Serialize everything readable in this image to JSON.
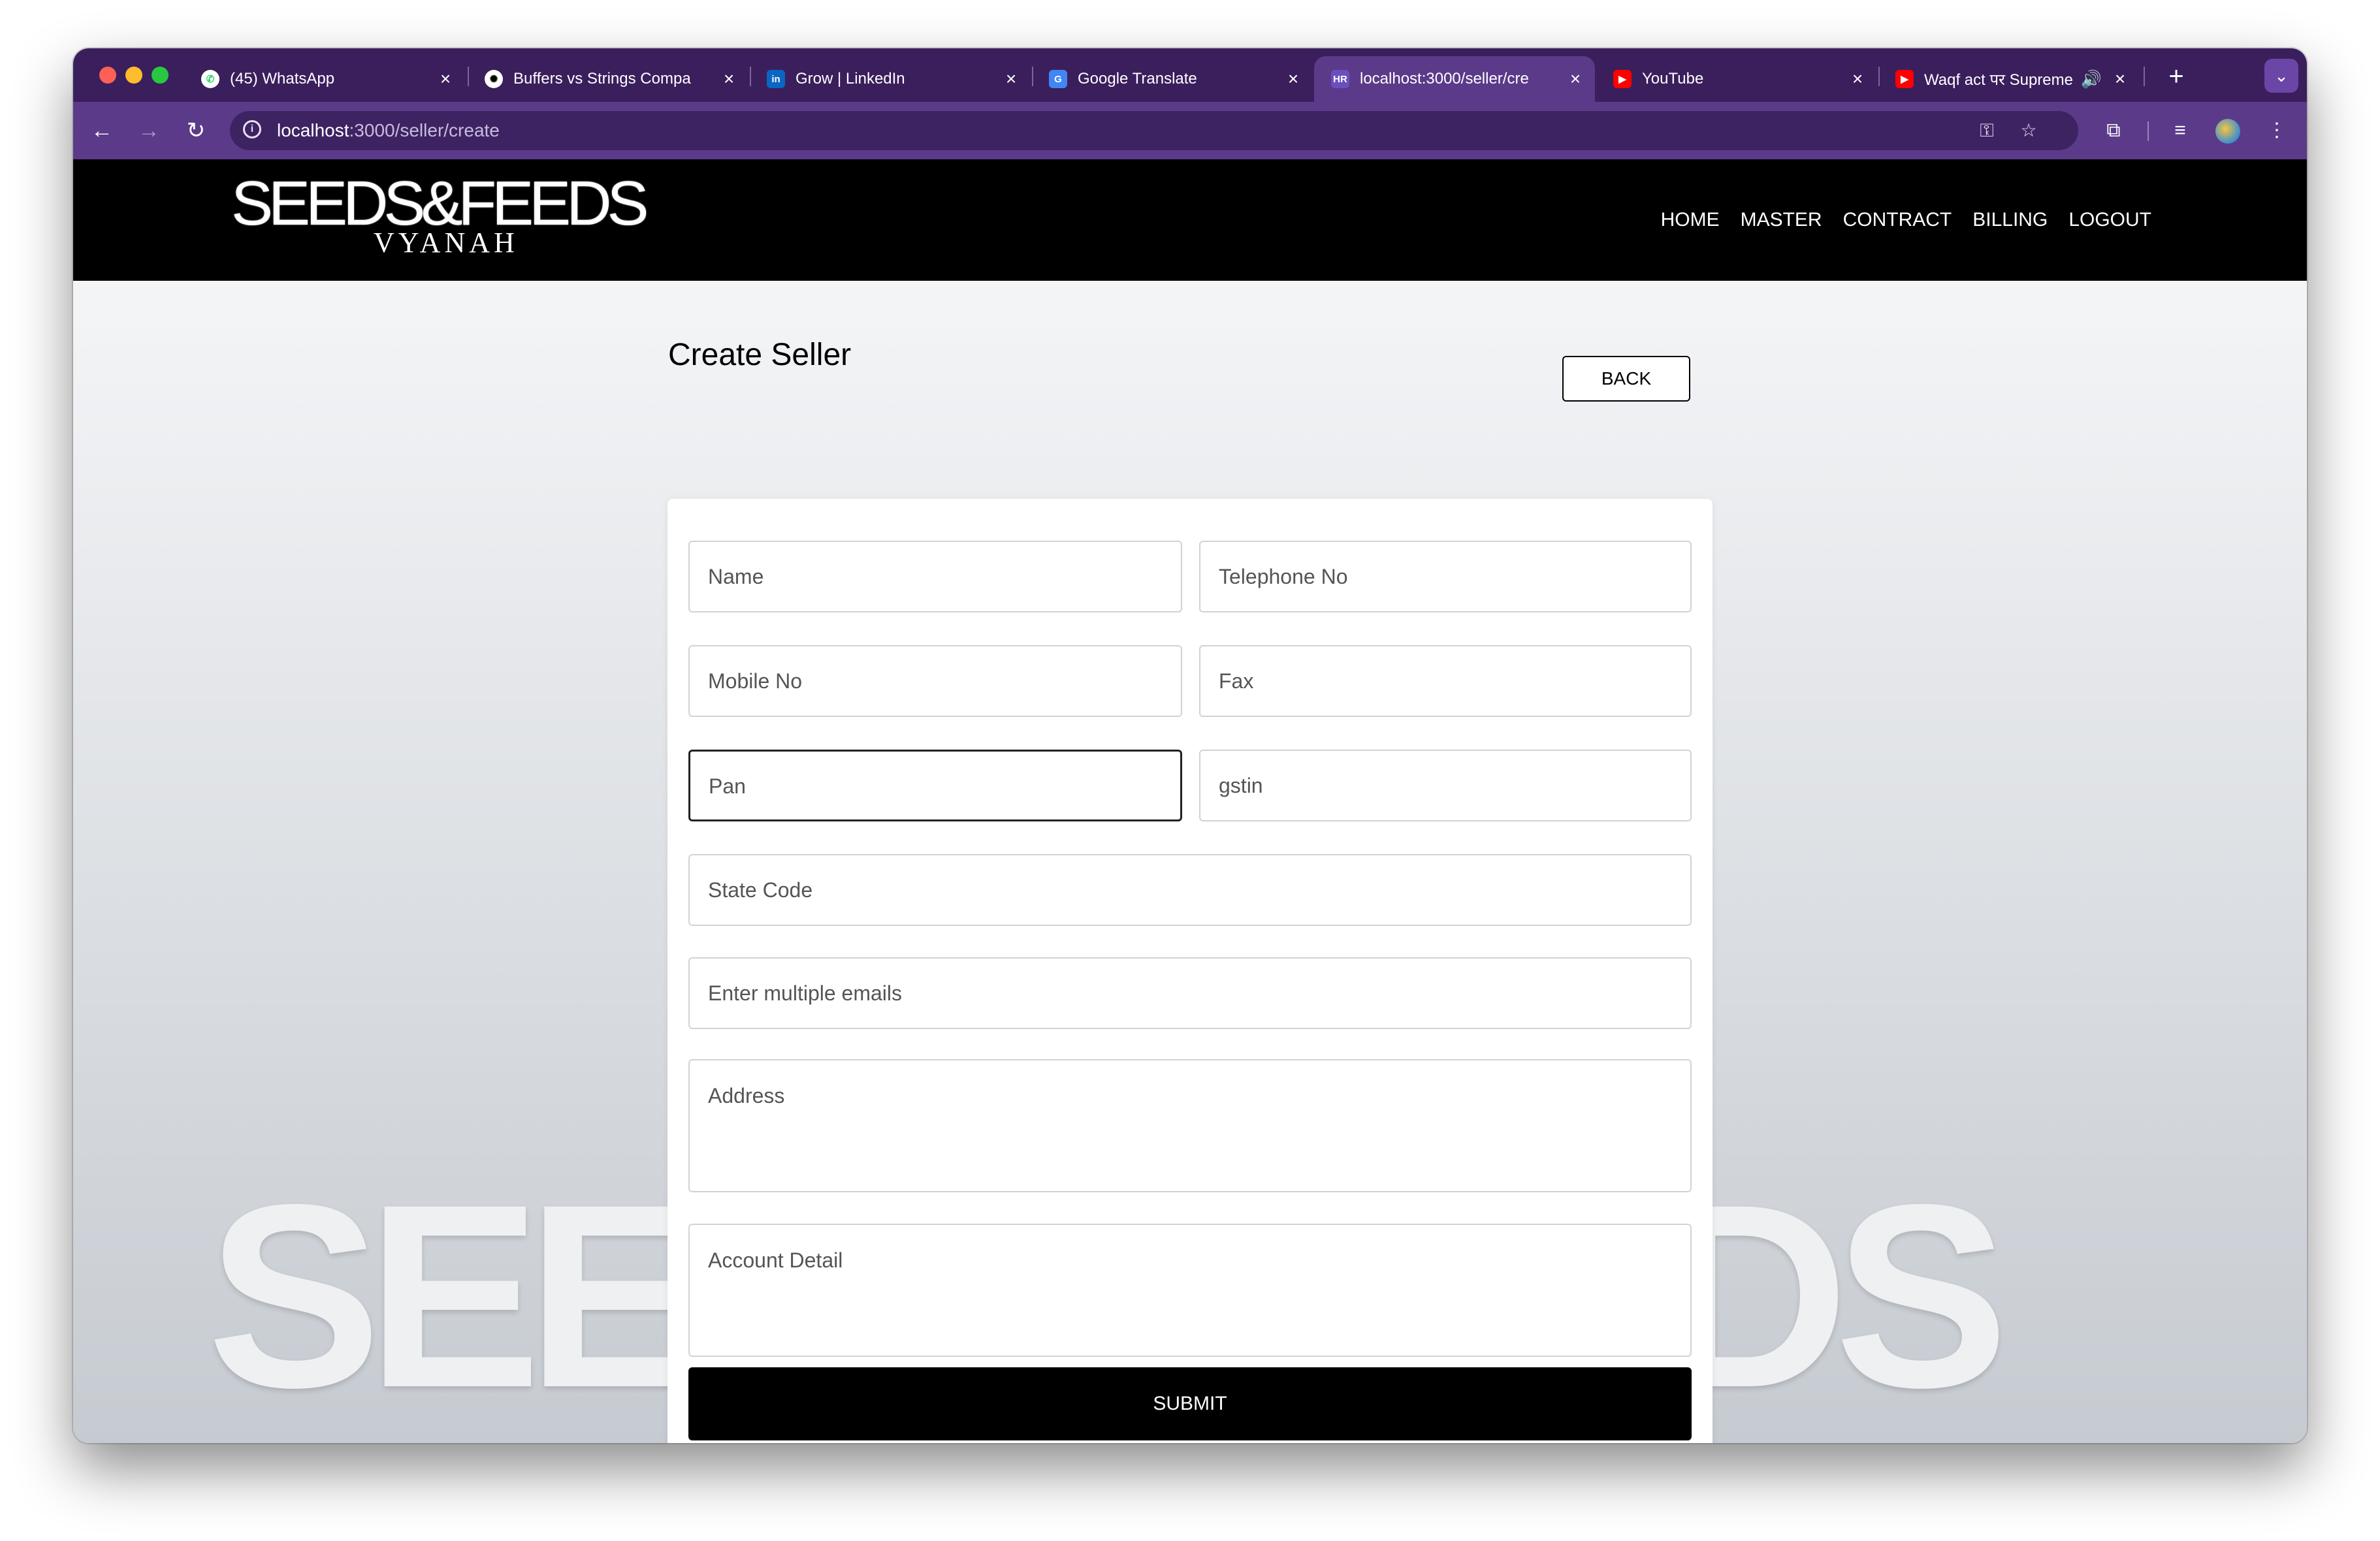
{
  "browser": {
    "tabs": [
      {
        "title": "(45) WhatsApp",
        "icon": "whatsapp-icon"
      },
      {
        "title": "Buffers vs Strings Compa",
        "icon": "openai-icon"
      },
      {
        "title": "Grow | LinkedIn",
        "icon": "linkedin-icon"
      },
      {
        "title": "Google Translate",
        "icon": "google-translate-icon"
      },
      {
        "title": "localhost:3000/seller/cre",
        "icon": "hr-icon",
        "favicon_text": "HR",
        "active": true
      },
      {
        "title": "YouTube",
        "icon": "youtube-icon"
      },
      {
        "title": "Waqf act पर Supreme",
        "icon": "youtube-icon",
        "audio": true
      }
    ],
    "url_host": "localhost",
    "url_path": ":3000/seller/create"
  },
  "site": {
    "logo_main": "SEEDS&FEEDS",
    "logo_sub": "VYANAH",
    "nav": [
      "HOME",
      "MASTER",
      "CONTRACT",
      "BILLING",
      "LOGOUT"
    ],
    "watermark": "SEEDS&FEEDS"
  },
  "page": {
    "title": "Create Seller",
    "back_label": "BACK",
    "submit_label": "SUBMIT"
  },
  "form": {
    "name": "Name",
    "telephone": "Telephone No",
    "mobile": "Mobile No",
    "fax": "Fax",
    "pan": "Pan",
    "gstin": "gstin",
    "state_code": "State Code",
    "emails": "Enter multiple emails",
    "address": "Address",
    "account_detail": "Account Detail"
  },
  "colors": {
    "tabstrip": "#3a1f5c",
    "toolbar": "#5b3a89",
    "header": "#000000",
    "submit": "#000000"
  }
}
